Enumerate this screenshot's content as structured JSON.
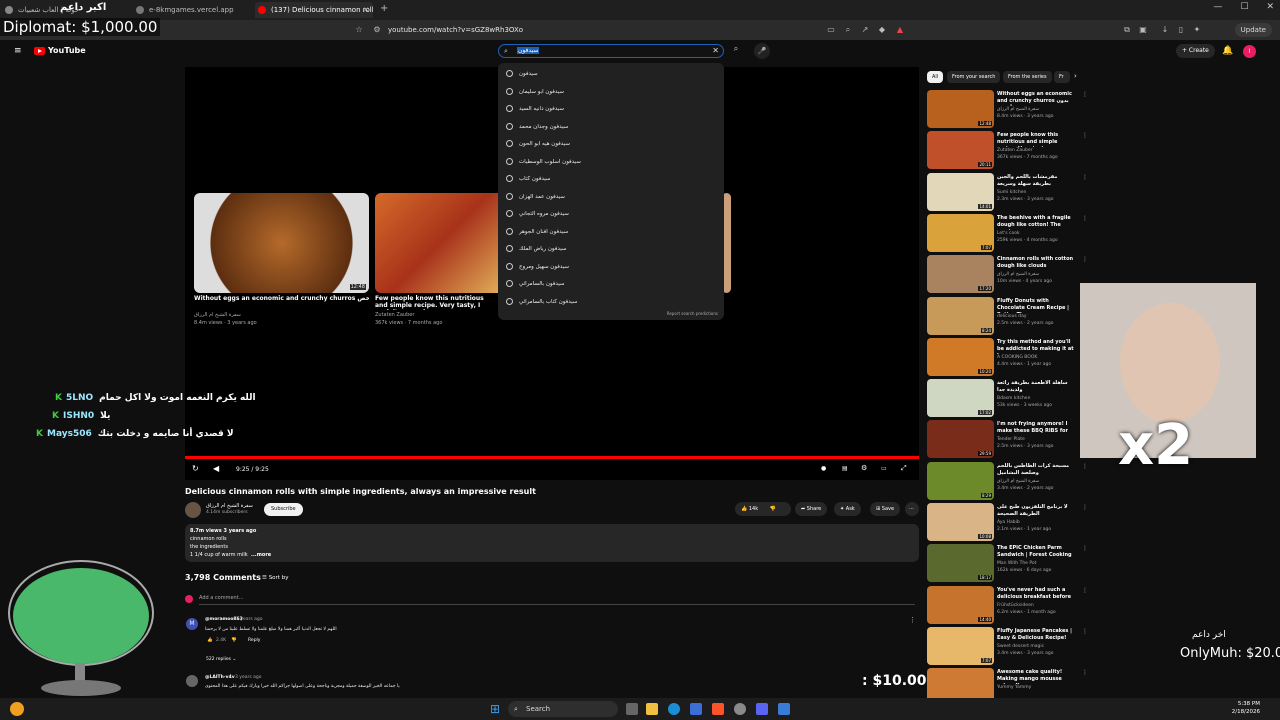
{
  "browser": {
    "tabs": [
      {
        "label": "حولة | العاب شعبيات",
        "icon_color": "#888888"
      },
      {
        "label": "e-8kmgames.vercel.app",
        "icon_color": "#777777"
      },
      {
        "label": "(137) Delicious cinnamon rolls wi",
        "icon_color": "#ff0000"
      }
    ],
    "url": "youtube.com/watch?v=sGZ8wRh3OXo",
    "update_label": "Update"
  },
  "youtube": {
    "logo_text": "YouTube",
    "search_value": "سيدفون",
    "create_label": "+ Create",
    "suggestions": [
      "سيدفون",
      "سيدفون ابو سليمان",
      "سيدفون دانيه السيد",
      "سيدفون وجدان محمد",
      "سيدفون هيه ابو الحون",
      "سيدفون اسلوب الوسطيات",
      "سيدفون كتاب",
      "سيدفون عمد الهزان",
      "سيدفون مروه التجاني",
      "سيدفون افنان الجوهر",
      "سيدفون رياض الملك",
      "سيدفون سهيل ومروج",
      "سيدفون بالسامرائي",
      "سيدفون كتاب بالسامرائي"
    ],
    "report_label": "Report search predictions"
  },
  "player": {
    "end_cards": [
      {
        "title": "Without eggs an economic and crunchy churros بدون بيض بأرخص",
        "channel": "سفرة الشيخ ام الرزاق",
        "meta": "8.4m views · 3 years ago",
        "duration": "12:48"
      },
      {
        "title": "Few people know this nutritious and simple recipe. Very tasty, I cook it every day",
        "channel": "Zutaten Zauber",
        "meta": "367k views · 7 months ago",
        "duration": ""
      }
    ],
    "time": "9:25 / 9:25",
    "progress": 1.0
  },
  "video": {
    "title": "Delicious cinnamon rolls with simple ingredients, always an impressive result",
    "channel": "سفرة الشيخ ام الرزاق",
    "subscribers": "4.14m subscribers",
    "subscribe_label": "Subscribe",
    "likes": "14k",
    "share_label": "Share",
    "ask_label": "Ask",
    "save_label": "Save",
    "description": {
      "meta": "8.7m views  3 years ago",
      "line1": "cinnamon rolls",
      "line2": "the ingredients",
      "line3": "1 1/4 cup of warm milk",
      "more": "...more"
    },
    "comments_count": "3,798 Comments",
    "sort_label": "Sort by",
    "add_comment": "Add a comment...",
    "comments": [
      {
        "author": "@moramoo863",
        "time": "3 years ago",
        "text": "اللهم لا تجعل الدنيا أكبر همنا ولا مبلغ علمنا ولا تسلط علينا من لا يرحمنا",
        "likes": "2.4K",
        "reply_label": "Reply",
        "replies": "522 replies",
        "avatar_color": "#3f51b5",
        "avatar_letter": "M"
      },
      {
        "author": "@LAITh-v4v",
        "time": "3 years ago",
        "text": "يا جماعه الخير الوصفة جميلة ومجربة وناجحة وعلى اصولها جزاكم الله خيرا وبارك فيكم على هذا المحتوى",
        "likes": "",
        "reply_label": "",
        "replies": "",
        "avatar_color": "#666666",
        "avatar_letter": ""
      }
    ]
  },
  "sidebar": {
    "chips": [
      "All",
      "From your search",
      "From the series",
      "Fr"
    ],
    "recommendations": [
      {
        "title": "Without eggs an economic and crunchy churros بدون بيض بأرخص",
        "channel": "سفرة الشيخ ام الرزاق",
        "meta": "8.4m views · 3 years ago",
        "duration": "12:48",
        "thumb_color": "#b8601e"
      },
      {
        "title": "Few people know this nutritious and simple recipe. Very tasty...",
        "channel": "Zutaten Zauber",
        "meta": "367k views · 7 months ago",
        "duration": "20:11",
        "thumb_color": "#c0502a"
      },
      {
        "title": "مقرمشات باللحم والجبن بطريقة سهلة وسريعة",
        "channel": "Sumi kitchen",
        "meta": "2.3m views · 3 years ago",
        "duration": "14:01",
        "thumb_color": "#e2d7b8"
      },
      {
        "title": "The beehive with a fragile dough like cotton! The most...",
        "channel": "Let's cook",
        "meta": "259k views · 4 months ago",
        "duration": "7:07",
        "thumb_color": "#d9a23a"
      },
      {
        "title": "Cinnamon rolls with cotton dough like clouds",
        "channel": "سفرة الشيخ ام الرزاق",
        "meta": "10m views · 4 years ago",
        "duration": "17:20",
        "thumb_color": "#a9825f"
      },
      {
        "title": "Fluffy Donuts with Chocolate Cream Recipe | Better Than...",
        "channel": "delicious day",
        "meta": "2.5m views · 2 years ago",
        "duration": "8:24",
        "thumb_color": "#c89a5a"
      },
      {
        "title": "Try this method and you'll be addicted to making it at home...",
        "channel": "A COOKING BOOK",
        "meta": "4.4m views · 1 year ago",
        "duration": "10:20",
        "thumb_color": "#d07a28"
      },
      {
        "title": "ساهلة الاطعمة بطريقة رائعة ولذيذة جدا",
        "channel": "Bdasm kitchen",
        "meta": "53k views · 3 weeks ago",
        "duration": "17:02",
        "thumb_color": "#cfd7c2"
      },
      {
        "title": "I'm not frying anymore! I make these BBQ RIBS for ever...",
        "channel": "Tender Plate",
        "meta": "2.5m views · 3 years ago",
        "duration": "29:59",
        "thumb_color": "#7a2c1a"
      },
      {
        "title": "مسبحة كرات الطاطس باللحم وصلصة البشاميل",
        "channel": "سفرة الشيخ ام الرزاق",
        "meta": "3.4m views · 2 years ago",
        "duration": "8:29",
        "thumb_color": "#6d8a2a"
      },
      {
        "title": "لا برنامج التلفزيون طبخ على الطريقة الصحيحة",
        "channel": "Aya Habib",
        "meta": "2.1m views · 1 year ago",
        "duration": "10:08",
        "thumb_color": "#d9b487"
      },
      {
        "title": "The EPIC Chicken Parm Sandwich | Forest Cooking",
        "channel": "Man With The Pot",
        "meta": "162k views · 6 days ago",
        "duration": "18:17",
        "thumb_color": "#5a6a2e"
      },
      {
        "title": "You've never had such a delicious breakfast before -...",
        "channel": "Frühstücksideen",
        "meta": "6.2m views · 1 month ago",
        "duration": "14:40",
        "thumb_color": "#c6732e"
      },
      {
        "title": "Fluffy Japanese Pancakes | Easy & Delicious Recipe!",
        "channel": "Sweet dessert magic",
        "meta": "3.4m views · 3 years ago",
        "duration": "7:07",
        "thumb_color": "#e8b86a"
      },
      {
        "title": "Awesome cake quality! Making mango mousse cake - Korean...",
        "channel": "Yummy Yammy",
        "meta": "",
        "duration": "",
        "thumb_color": "#cf7a34"
      }
    ]
  },
  "overlays": {
    "diplomat": "Diplomat: $1,000.00",
    "arabic_top": "اكبر داعم",
    "chat": [
      {
        "name": "5LNO",
        "msg": "الله يكرم النعمه اموت ولا اكل حمام"
      },
      {
        "name": "ISHN0",
        "msg": "يلا"
      },
      {
        "name": "Mays506",
        "msg": "لا قصدي أنا صايمه و دخلت بتك"
      }
    ],
    "webcam_label": "x2",
    "tip_amount": ": $10.00",
    "onlymuh_label": "اخر داعم",
    "onlymuh_amount": "OnlyMuh: $20.0"
  },
  "taskbar": {
    "search_placeholder": "Search",
    "time": "5:38 PM",
    "date": "2/18/2026"
  }
}
